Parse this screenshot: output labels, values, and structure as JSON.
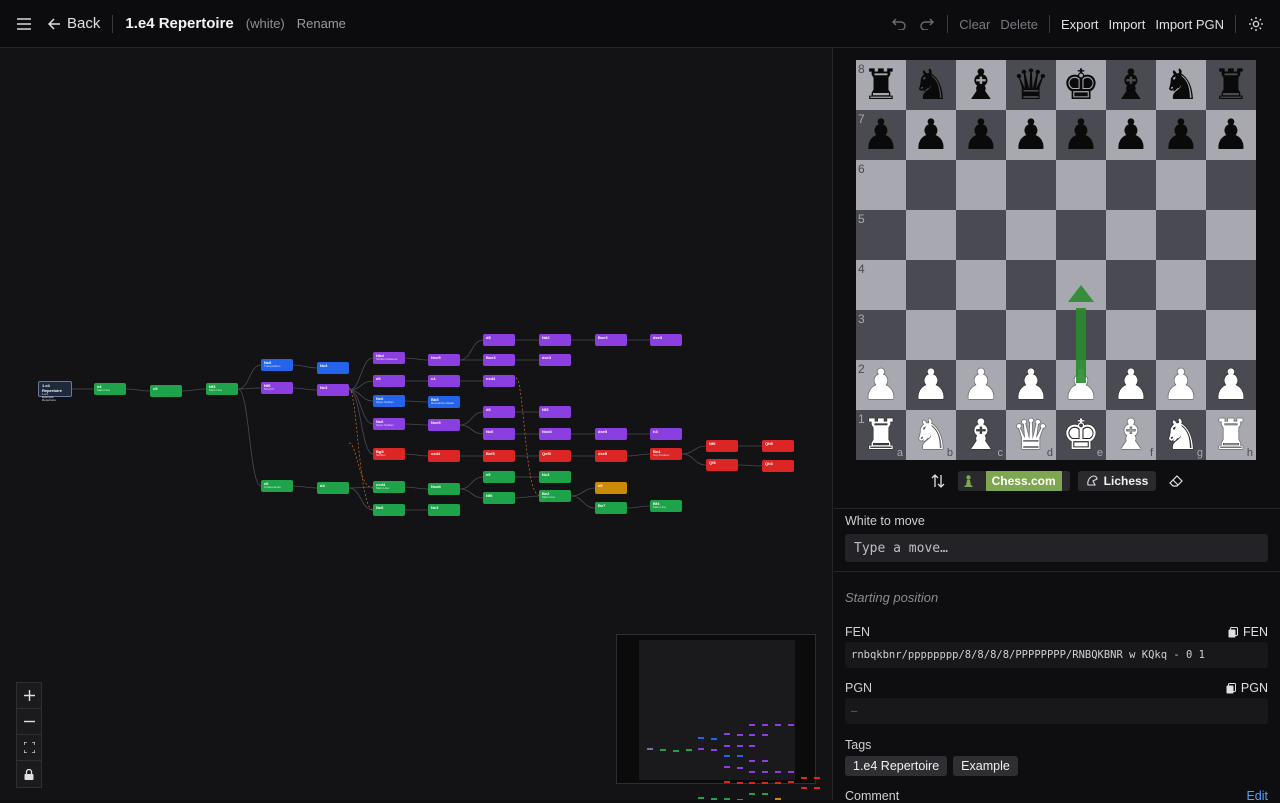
{
  "header": {
    "back_label": "Back",
    "title": "1.e4 Repertoire",
    "side": "(white)",
    "rename_label": "Rename",
    "clear_label": "Clear",
    "delete_label": "Delete",
    "export_label": "Export",
    "import_label": "Import",
    "import_pgn_label": "Import PGN"
  },
  "tree": {
    "root": {
      "title": "1.e4 Repertoire",
      "sub1": "1.e4",
      "sub2": "Example",
      "sub3": "Repertoire"
    },
    "nodes": [
      {
        "label": "e4",
        "sub": "Main Line"
      },
      {
        "label": "c5",
        "sub": ""
      },
      {
        "label": "Nf3",
        "sub": "Main Line"
      },
      {
        "label": "Nc6",
        "sub": "Tranposition"
      },
      {
        "label": "Nc3",
        "sub": ""
      },
      {
        "label": "Nf6",
        "sub": "Nimzo?"
      },
      {
        "label": "Nc3",
        "sub": ""
      },
      {
        "label": "Nbd",
        "sub": "Sicilian Defense"
      },
      {
        "label": "Nxe5",
        "sub": ""
      },
      {
        "label": "d6",
        "sub": ""
      },
      {
        "label": "c4",
        "sub": ""
      },
      {
        "label": "Nc6",
        "sub": "Open Sicilian"
      },
      {
        "label": "Bb5",
        "sub": "Rossolimo Attack"
      },
      {
        "label": "Nc6",
        "sub": "Open Sicilian"
      },
      {
        "label": "Nxe5",
        "sub": ""
      },
      {
        "label": "Bg5",
        "sub": "Sicilian"
      },
      {
        "label": "cxd4",
        "sub": ""
      },
      {
        "label": "e6",
        "sub": "Chebanenko"
      },
      {
        "label": "d4",
        "sub": ""
      },
      {
        "label": "cxd4",
        "sub": "Main Line"
      },
      {
        "label": "Nxd4",
        "sub": ""
      },
      {
        "label": "Nc6",
        "sub": ""
      },
      {
        "label": "Nc3",
        "sub": ""
      },
      {
        "label": "d5",
        "sub": ""
      },
      {
        "label": "Nd2",
        "sub": ""
      },
      {
        "label": "Bxe3",
        "sub": ""
      },
      {
        "label": "dxe3",
        "sub": ""
      },
      {
        "label": "Bxe3",
        "sub": ""
      },
      {
        "label": "dxe3",
        "sub": ""
      },
      {
        "label": "exd4",
        "sub": ""
      },
      {
        "label": "d6",
        "sub": ""
      },
      {
        "label": "Nf3",
        "sub": ""
      },
      {
        "label": "Nc6",
        "sub": ""
      },
      {
        "label": "Nxd4",
        "sub": ""
      },
      {
        "label": "dxe5",
        "sub": ""
      },
      {
        "label": "h3",
        "sub": ""
      },
      {
        "label": "Bxf3",
        "sub": ""
      },
      {
        "label": "Qxf3",
        "sub": ""
      },
      {
        "label": "dxe5",
        "sub": ""
      },
      {
        "label": "Bc4",
        "sub": "Top Position"
      },
      {
        "label": "Nf6",
        "sub": ""
      },
      {
        "label": "Qh5",
        "sub": ""
      },
      {
        "label": "Qf6",
        "sub": ""
      },
      {
        "label": "Qh3",
        "sub": ""
      },
      {
        "label": "e5",
        "sub": ""
      },
      {
        "label": "Nc3",
        "sub": ""
      },
      {
        "label": "Nf6",
        "sub": ""
      },
      {
        "label": "Be2",
        "sub": "Main Line"
      },
      {
        "label": "e5",
        "sub": ""
      },
      {
        "label": "Be7",
        "sub": ""
      },
      {
        "label": "Bf4",
        "sub": "Main Line"
      }
    ]
  },
  "board": {
    "light_color": "#a7a8b0",
    "dark_color": "#4a4b52",
    "ranks": [
      "8",
      "7",
      "6",
      "5",
      "4",
      "3",
      "2",
      "1"
    ],
    "files": [
      "a",
      "b",
      "c",
      "d",
      "e",
      "f",
      "g",
      "h"
    ],
    "arrow_color": "#2a8a2e",
    "arrow_from": "e2",
    "arrow_to": "e4"
  },
  "tools": {
    "chesscom_label": "Chess.com",
    "lichess_label": "Lichess"
  },
  "move": {
    "turn_label": "White to move",
    "placeholder": "Type a move…"
  },
  "info": {
    "start_label": "Starting position",
    "fen_label": "FEN",
    "fen_copy": "FEN",
    "fen_value": "rnbqkbnr/pppppppp/8/8/8/8/PPPPPPPP/RNBQKBNR w KQkq - 0 1",
    "pgn_label": "PGN",
    "pgn_copy": "PGN",
    "pgn_value": "–",
    "tags_label": "Tags",
    "tags": [
      "1.e4 Repertoire",
      "Example"
    ],
    "comment_label": "Comment",
    "edit_label": "Edit"
  }
}
